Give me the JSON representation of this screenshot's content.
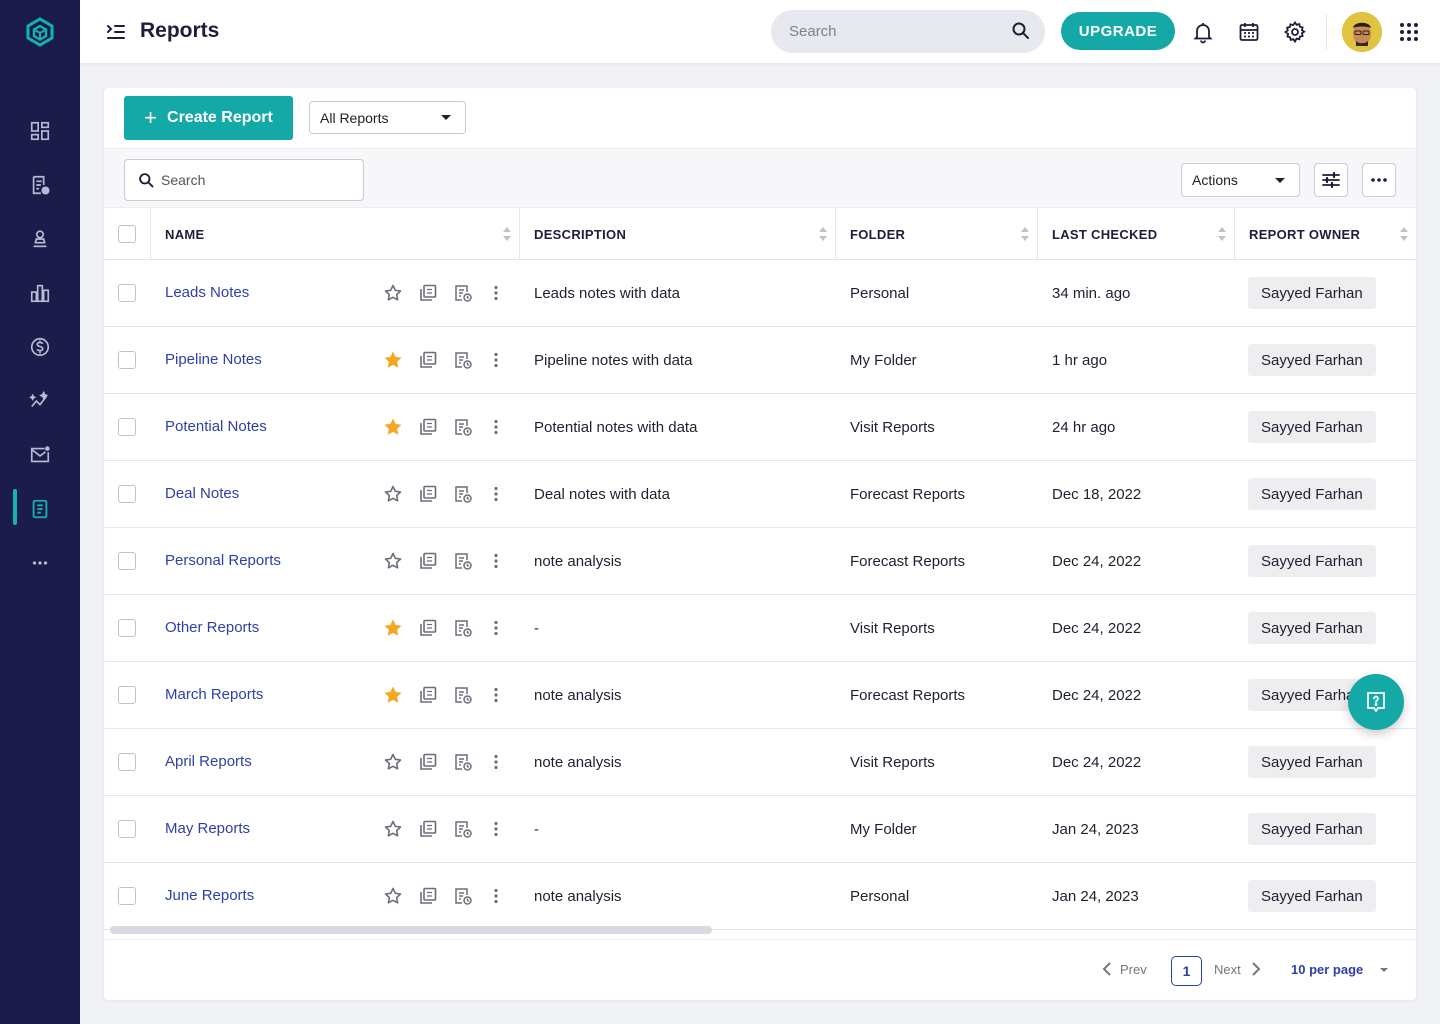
{
  "header": {
    "title": "Reports",
    "search_placeholder": "Search",
    "upgrade_label": "UPGRADE"
  },
  "sidebar": {
    "items": [
      {
        "name": "dashboard-icon"
      },
      {
        "name": "records-icon"
      },
      {
        "name": "contacts-icon"
      },
      {
        "name": "analytics-icon"
      },
      {
        "name": "billing-icon"
      },
      {
        "name": "insights-icon"
      },
      {
        "name": "mail-icon"
      },
      {
        "name": "reports-icon",
        "active": true
      },
      {
        "name": "more-icon"
      }
    ]
  },
  "toolbar": {
    "create_label": "Create Report",
    "filter_value": "All Reports",
    "search_placeholder": "Search",
    "actions_label": "Actions"
  },
  "table": {
    "columns": [
      "NAME",
      "DESCRIPTION",
      "FOLDER",
      "LAST CHECKED",
      "REPORT OWNER"
    ],
    "rows": [
      {
        "name": "Leads Notes",
        "starred": false,
        "description": "Leads notes with data",
        "folder": "Personal",
        "last_checked": "34 min. ago",
        "owner": "Sayyed Farhan"
      },
      {
        "name": "Pipeline Notes",
        "starred": true,
        "description": "Pipeline notes with data",
        "folder": "My Folder",
        "last_checked": "1 hr ago",
        "owner": "Sayyed Farhan"
      },
      {
        "name": "Potential Notes",
        "starred": true,
        "description": "Potential notes with data",
        "folder": "Visit Reports",
        "last_checked": "24 hr ago",
        "owner": "Sayyed Farhan"
      },
      {
        "name": "Deal Notes",
        "starred": false,
        "description": "Deal notes with data",
        "folder": "Forecast Reports",
        "last_checked": "Dec 18, 2022",
        "owner": "Sayyed Farhan"
      },
      {
        "name": "Personal Reports",
        "starred": false,
        "description": "note analysis",
        "folder": "Forecast Reports",
        "last_checked": "Dec 24, 2022",
        "owner": "Sayyed Farhan"
      },
      {
        "name": "Other Reports",
        "starred": true,
        "description": "-",
        "folder": "Visit Reports",
        "last_checked": "Dec 24, 2022",
        "owner": "Sayyed Farhan"
      },
      {
        "name": "March Reports",
        "starred": true,
        "description": "note analysis",
        "folder": "Forecast Reports",
        "last_checked": "Dec 24, 2022",
        "owner": "Sayyed Farhan"
      },
      {
        "name": "April Reports",
        "starred": false,
        "description": "note analysis",
        "folder": "Visit Reports",
        "last_checked": "Dec 24, 2022",
        "owner": "Sayyed Farhan"
      },
      {
        "name": "May Reports",
        "starred": false,
        "description": "-",
        "folder": "My Folder",
        "last_checked": "Jan 24, 2023",
        "owner": "Sayyed Farhan"
      },
      {
        "name": "June Reports",
        "starred": false,
        "description": "note analysis",
        "folder": "Personal",
        "last_checked": "Jan 24, 2023",
        "owner": "Sayyed Farhan"
      }
    ]
  },
  "pagination": {
    "prev_label": "Prev",
    "current_page": "1",
    "next_label": "Next",
    "per_page": "10 per page"
  },
  "colors": {
    "accent": "#14a8a6",
    "sidebar": "#1b1c4a",
    "link": "#2e3fa7",
    "star": "#f5a623"
  }
}
